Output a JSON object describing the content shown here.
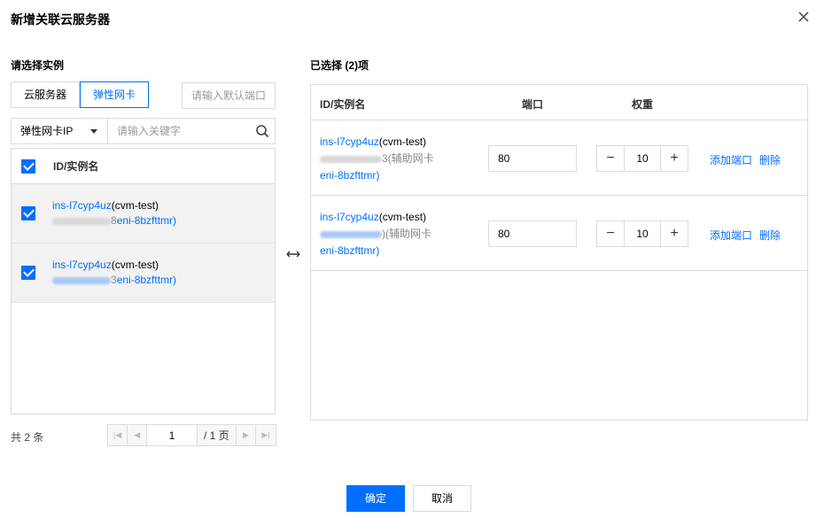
{
  "dialog": {
    "title": "新增关联云服务器",
    "close_icon": "close-icon"
  },
  "left": {
    "section_title": "请选择实例",
    "tabs": [
      {
        "label": "云服务器",
        "active": false
      },
      {
        "label": "弹性网卡",
        "active": true
      }
    ],
    "default_port_placeholder": "请输入默认端口",
    "filter": {
      "select_value": "弹性网卡IP",
      "keyword_placeholder": "请输入关键字"
    },
    "table": {
      "header": "ID/实例名",
      "rows": [
        {
          "id": "ins-l7cyp4uz",
          "name": "(cvm-test)",
          "eni_suffix": "8",
          "eni": "eni-8bzfttmr)"
        },
        {
          "id": "ins-l7cyp4uz",
          "name": "(cvm-test)",
          "eni_suffix": "3",
          "eni": "eni-8bzfttmr)"
        }
      ]
    },
    "total": "共 2 条",
    "pager": {
      "page": "1",
      "total_pages": "/ 1 页"
    }
  },
  "right": {
    "section_title": "已选择 (2)项",
    "headers": {
      "id": "ID/实例名",
      "port": "端口",
      "weight": "权重"
    },
    "rows": [
      {
        "id": "ins-l7cyp4uz",
        "name": "(cvm-test)",
        "secondary": "3(辅助网卡",
        "eni": "eni-8bzfttmr)",
        "port": "80",
        "weight": "10",
        "add_port": "添加端口",
        "delete": "删除"
      },
      {
        "id": "ins-l7cyp4uz",
        "name": "(cvm-test)",
        "secondary": ")(辅助网卡",
        "eni": "eni-8bzfttmr)",
        "port": "80",
        "weight": "10",
        "add_port": "添加端口",
        "delete": "删除"
      }
    ]
  },
  "footer": {
    "confirm": "确定",
    "cancel": "取消"
  },
  "colors": {
    "accent": "#006eff",
    "border": "#dcdcdc",
    "selected_row": "#f2f2f2"
  }
}
